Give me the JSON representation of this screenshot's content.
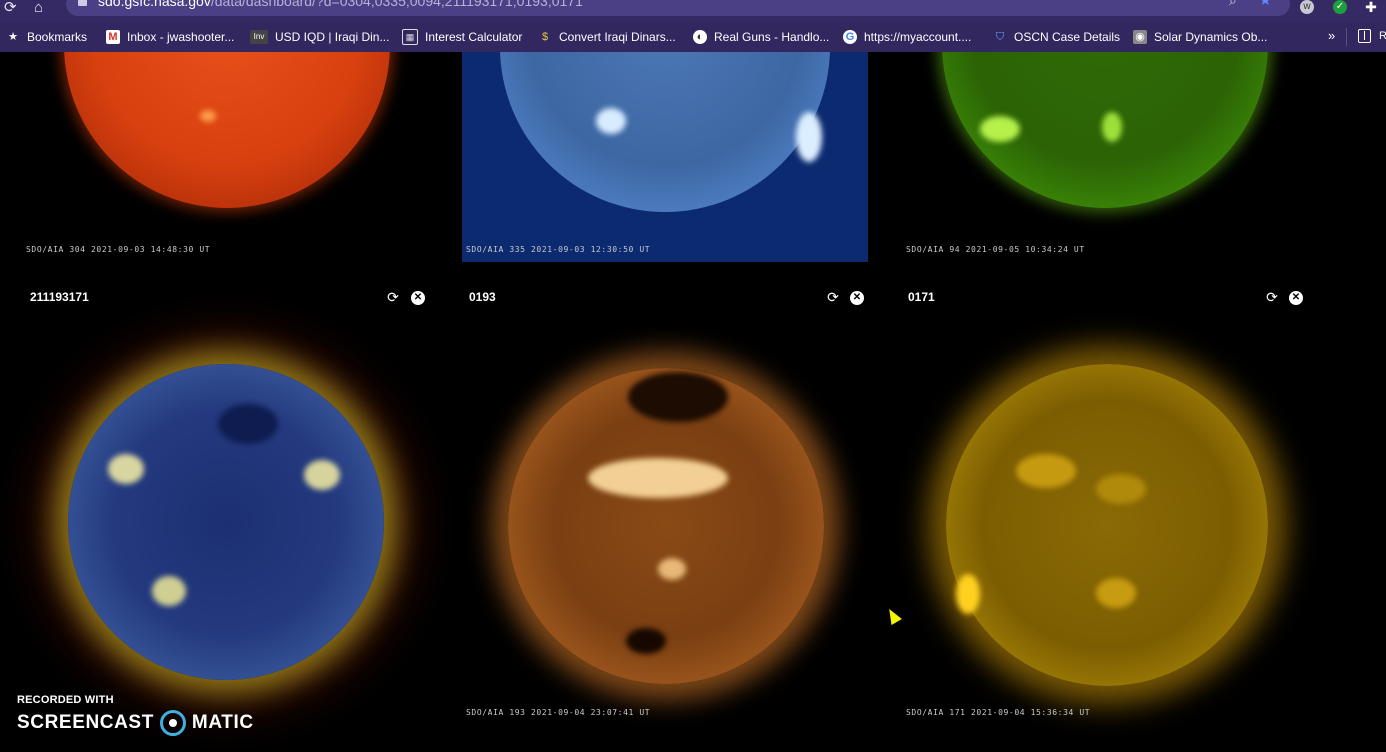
{
  "browser": {
    "url_host": "sdo.gsfc.nasa.gov",
    "url_path": "/data/dashboard/?d=0304;0335;0094;211193171;0193;0171"
  },
  "bookmarks": [
    {
      "label": "Bookmarks",
      "icon": "star-icon"
    },
    {
      "label": "Inbox - jwashooter...",
      "icon": "gmail-icon"
    },
    {
      "label": "USD IQD | Iraqi Din...",
      "icon": "investing-icon"
    },
    {
      "label": "Interest Calculator",
      "icon": "calculator-icon"
    },
    {
      "label": "Convert Iraqi Dinars...",
      "icon": "currency-icon"
    },
    {
      "label": "Real Guns - Handlo...",
      "icon": "globe-icon"
    },
    {
      "label": "https://myaccount....",
      "icon": "google-icon"
    },
    {
      "label": "OSCN Case Details",
      "icon": "shield-icon"
    },
    {
      "label": "Solar Dynamics Ob...",
      "icon": "sdo-icon"
    }
  ],
  "panels_top": [
    {
      "caption_instrument": "SDO/AIA",
      "caption_channel": "304",
      "caption_time": "2021-09-03 14:48:30 UT"
    },
    {
      "caption_instrument": "SDO/AIA",
      "caption_channel": "335",
      "caption_time": "2021-09-03 12:30:50 UT"
    },
    {
      "caption_instrument": "SDO/AIA",
      "caption_channel": "94",
      "caption_time": "2021-09-05 10:34:24 UT"
    }
  ],
  "panels_bottom": [
    {
      "title": "211193171",
      "caption_instrument": "",
      "caption_channel": "",
      "caption_time": ""
    },
    {
      "title": "0193",
      "caption_instrument": "SDO/AIA",
      "caption_channel": "193",
      "caption_time": "2021-09-04 23:07:41 UT"
    },
    {
      "title": "0171",
      "caption_instrument": "SDO/AIA",
      "caption_channel": "171",
      "caption_time": "2021-09-04 15:36:34 UT"
    }
  ],
  "controls": {
    "refresh_glyph": "⟳",
    "close_glyph": "✕"
  },
  "watermark": {
    "small": "RECORDED WITH",
    "big_left": "SCREENCAST",
    "big_right": "MATIC"
  }
}
